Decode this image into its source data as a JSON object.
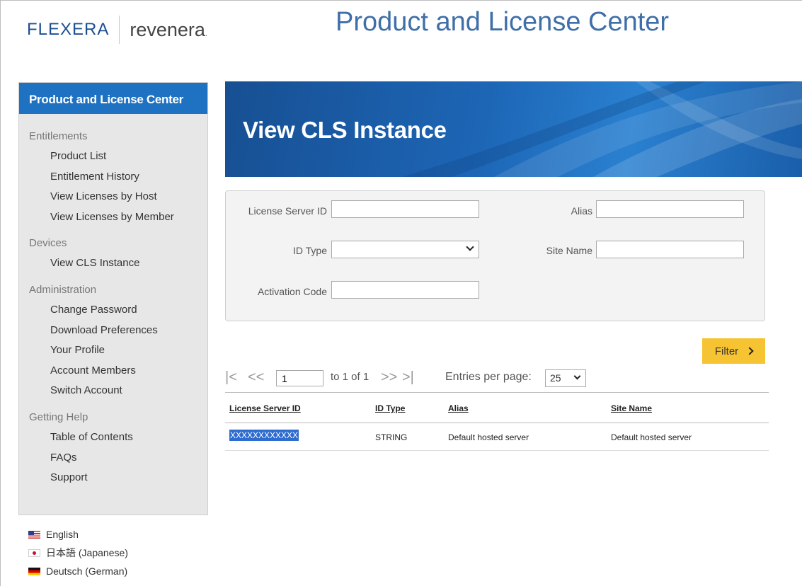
{
  "brand": {
    "logo_left": "FLEXERA",
    "logo_right": "revenera",
    "logo_right_mark": ".",
    "app_title": "Product and License Center"
  },
  "sidebar": {
    "header": "Product and License Center",
    "sections": [
      {
        "title": "Entitlements",
        "items": [
          "Product List",
          "Entitlement History",
          "View Licenses by Host",
          "View Licenses by Member"
        ]
      },
      {
        "title": "Devices",
        "items": [
          "View CLS Instance"
        ]
      },
      {
        "title": "Administration",
        "items": [
          "Change Password",
          "Download Preferences",
          "Your Profile",
          "Account Members",
          "Switch Account"
        ]
      },
      {
        "title": "Getting Help",
        "items": [
          "Table of Contents",
          "FAQs",
          "Support"
        ]
      }
    ]
  },
  "languages": [
    {
      "label": "English",
      "flag": "us-flag-icon"
    },
    {
      "label": "日本語 (Japanese)",
      "flag": "jp-flag-icon"
    },
    {
      "label": "Deutsch (German)",
      "flag": "de-flag-icon"
    }
  ],
  "page": {
    "title": "View CLS Instance"
  },
  "filters": {
    "license_server_id": {
      "label": "License Server ID",
      "value": ""
    },
    "alias": {
      "label": "Alias",
      "value": ""
    },
    "id_type": {
      "label": "ID Type",
      "value": ""
    },
    "site_name": {
      "label": "Site Name",
      "value": ""
    },
    "activation_code": {
      "label": "Activation Code",
      "value": ""
    },
    "filter_button": "Filter"
  },
  "pagination": {
    "page_value": "1",
    "range_text": "to 1 of 1",
    "entries_label": "Entries per page:",
    "entries_value": "25"
  },
  "table": {
    "columns": [
      "License Server ID",
      "ID Type",
      "Alias",
      "Site Name"
    ],
    "rows": [
      [
        "XXXXXXXXXXXX",
        "STRING",
        "Default hosted server",
        "Default hosted server"
      ]
    ]
  },
  "colors": {
    "sidebar_header": "#1f72c2",
    "banner": "#1d66b6",
    "filter_button": "#f6c333",
    "title_text": "#3f6fa8"
  }
}
